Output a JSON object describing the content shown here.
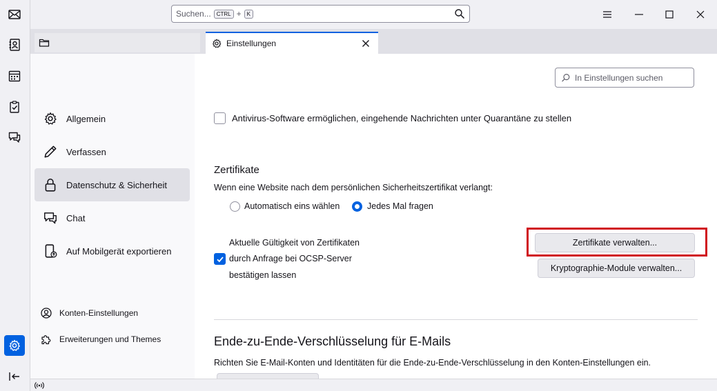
{
  "titlebar": {
    "search_placeholder": "Suchen...",
    "search_key1": "CTRL",
    "search_plus": "+",
    "search_key2": "K"
  },
  "tabs": [
    {
      "label": ""
    },
    {
      "label": "Einstellungen"
    }
  ],
  "nav": {
    "items": [
      {
        "label": "Allgemein"
      },
      {
        "label": "Verfassen"
      },
      {
        "label": "Datenschutz & Sicherheit"
      },
      {
        "label": "Chat"
      },
      {
        "label": "Auf Mobilgerät exportieren"
      }
    ],
    "bottom": [
      {
        "label": "Konten-Einstellungen"
      },
      {
        "label": "Erweiterungen und Themes"
      }
    ]
  },
  "content": {
    "search_placeholder": "In Einstellungen suchen",
    "antivirus_label": "Antivirus-Software ermöglichen, eingehende Nachrichten unter Quarantäne zu stellen",
    "certs": {
      "heading": "Zertifikate",
      "question": "Wenn eine Website nach dem persönlichen Sicherheitszertifikat verlangt:",
      "option_auto": "Automatisch eins wählen",
      "option_ask": "Jedes Mal fragen",
      "ocsp_line1": "Aktuelle Gültigkeit von Zertifikaten",
      "ocsp_line2": "durch Anfrage bei OCSP-Server",
      "ocsp_line3": "bestätigen lassen",
      "manage_certs_button": "Zertifikate verwalten...",
      "crypto_button": "Kryptographie-Module verwalten..."
    },
    "e2e": {
      "heading": "Ende-zu-Ende-Verschlüsselung für E-Mails",
      "description": "Richten Sie E-Mail-Konten und Identitäten für die Ende-zu-Ende-Verschlüsselung in den Konten-Einstellungen ein."
    }
  },
  "colors": {
    "accent": "#0061e0",
    "highlight": "#d0101b"
  }
}
